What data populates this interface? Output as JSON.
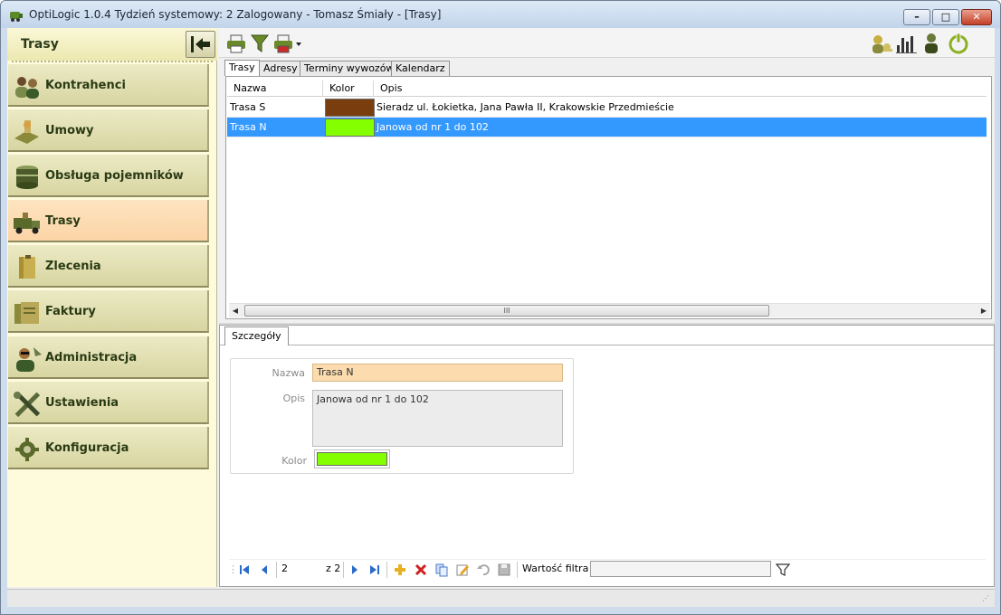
{
  "window": {
    "title": "OptiLogic 1.0.4  Tydzień systemowy: 2  Zalogowany - Tomasz Śmiały - [Trasy]",
    "min_glyph": "–",
    "max_glyph": "□",
    "close_glyph": "✕"
  },
  "left_panel": {
    "title": "Trasy",
    "items": [
      {
        "label": "Kontrahenci",
        "icon": "contacts-icon"
      },
      {
        "label": "Umowy",
        "icon": "handshake-icon"
      },
      {
        "label": "Obsługa pojemników",
        "icon": "containers-icon"
      },
      {
        "label": "Trasy",
        "icon": "truck-icon",
        "active": true
      },
      {
        "label": "Zlecenia",
        "icon": "orders-icon"
      },
      {
        "label": "Faktury",
        "icon": "invoices-icon"
      },
      {
        "label": "Administracja",
        "icon": "admin-icon"
      },
      {
        "label": "Ustawienia",
        "icon": "tools-icon"
      },
      {
        "label": "Konfiguracja",
        "icon": "gear-icon"
      }
    ]
  },
  "toolbar": {
    "left_icons": [
      "print-icon",
      "filter-icon",
      "print-dropdown-icon"
    ],
    "right_icons": [
      "user-key-icon",
      "stats-icon",
      "user-icon",
      "power-icon"
    ]
  },
  "tabs": [
    {
      "label": "Trasy",
      "active": true
    },
    {
      "label": "Adresy"
    },
    {
      "label": "Terminy wywozów"
    },
    {
      "label": "Kalendarz"
    }
  ],
  "grid": {
    "columns": [
      "Nazwa",
      "Kolor",
      "Opis"
    ],
    "rows": [
      {
        "nazwa": "Trasa S",
        "color": "#7a3e0e",
        "opis": "Sieradz ul. Łokietka, Jana Pawła II, Krakowskie Przedmieście"
      },
      {
        "nazwa": "Trasa N",
        "color": "#84ff00",
        "opis": "Janowa od nr 1 do 102",
        "selected": true
      }
    ],
    "scroll_mark": "III"
  },
  "details": {
    "tab": "Szczegóły",
    "labels": {
      "nazwa": "Nazwa",
      "opis": "Opis",
      "kolor": "Kolor"
    },
    "nazwa_value": "Trasa N",
    "opis_value": "Janowa od nr 1 do 102",
    "kolor_value": "#84ff00"
  },
  "record_nav": {
    "position": "2",
    "total": "z 2",
    "filter_label": "Wartość filtra",
    "filter_value": ""
  },
  "colors": {
    "accent": "#3399ff",
    "active_nav": "#fcd8ae",
    "panel": "#fdfbdb"
  }
}
